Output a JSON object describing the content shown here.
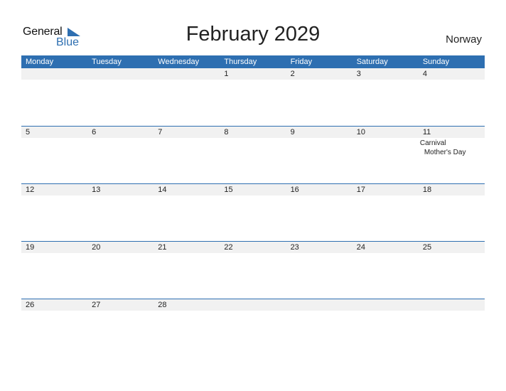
{
  "logo": {
    "general": "General",
    "blue": "Blue"
  },
  "title": "February 2029",
  "country": "Norway",
  "weekdays": [
    "Monday",
    "Tuesday",
    "Wednesday",
    "Thursday",
    "Friday",
    "Saturday",
    "Sunday"
  ],
  "weeks": [
    {
      "days": [
        "",
        "",
        "",
        "1",
        "2",
        "3",
        "4"
      ]
    },
    {
      "days": [
        "5",
        "6",
        "7",
        "8",
        "9",
        "10",
        "11"
      ]
    },
    {
      "days": [
        "12",
        "13",
        "14",
        "15",
        "16",
        "17",
        "18"
      ]
    },
    {
      "days": [
        "19",
        "20",
        "21",
        "22",
        "23",
        "24",
        "25"
      ]
    },
    {
      "days": [
        "26",
        "27",
        "28",
        "",
        "",
        "",
        ""
      ]
    }
  ],
  "events": {
    "feb11": [
      "Carnival",
      "Mother's Day"
    ]
  },
  "colors": {
    "accent": "#2e6fb1",
    "day_band": "#f1f1f1"
  }
}
